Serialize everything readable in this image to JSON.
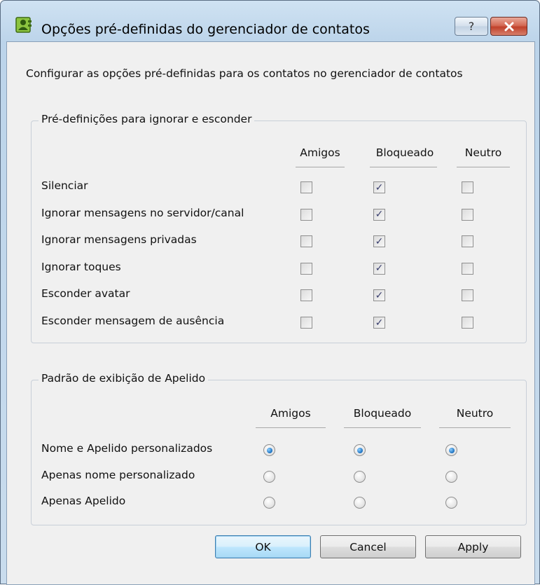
{
  "window": {
    "title": "Opções pré-definidas do gerenciador de contatos",
    "help_label": "?",
    "close_label": "✕"
  },
  "intro": "Configurar as opções pré-definidas para os contatos no gerenciador de contatos",
  "group_ignore": {
    "legend": "Pré-definições para ignorar e esconder",
    "columns": [
      "Amigos",
      "Bloqueado",
      "Neutro"
    ],
    "rows": [
      {
        "label": "Silenciar",
        "values": [
          false,
          true,
          false
        ]
      },
      {
        "label": "Ignorar mensagens no servidor/canal",
        "values": [
          false,
          true,
          false
        ]
      },
      {
        "label": "Ignorar mensagens privadas",
        "values": [
          false,
          true,
          false
        ]
      },
      {
        "label": "Ignorar toques",
        "values": [
          false,
          true,
          false
        ]
      },
      {
        "label": "Esconder avatar",
        "values": [
          false,
          true,
          false
        ]
      },
      {
        "label": "Esconder mensagem de ausência",
        "values": [
          false,
          true,
          false
        ]
      }
    ]
  },
  "group_nickname": {
    "legend": "Padrão de exibição de Apelido",
    "columns": [
      "Amigos",
      "Bloqueado",
      "Neutro"
    ],
    "rows": [
      {
        "label": "Nome e Apelido personalizados",
        "values": [
          true,
          true,
          true
        ]
      },
      {
        "label": "Apenas nome personalizado",
        "values": [
          false,
          false,
          false
        ]
      },
      {
        "label": "Apenas Apelido",
        "values": [
          false,
          false,
          false
        ]
      }
    ]
  },
  "buttons": {
    "ok": "OK",
    "cancel": "Cancel",
    "apply": "Apply"
  },
  "colors": {
    "titlebar": "#bcd4ea",
    "dialog_bg": "#f0f0f0",
    "close_red": "#c0412b",
    "radio_blue": "#1a6fbf"
  }
}
